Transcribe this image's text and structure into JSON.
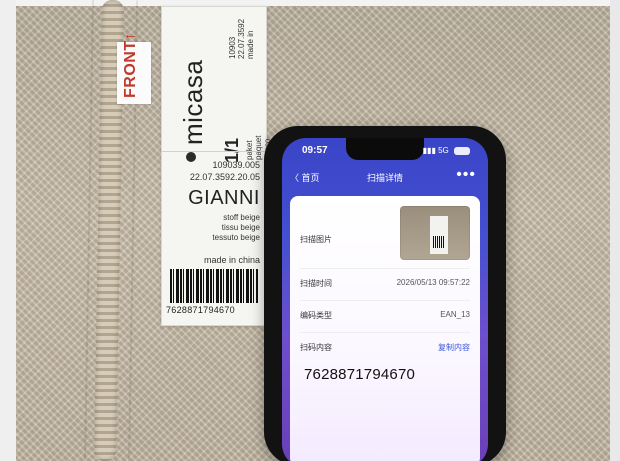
{
  "front_tag": {
    "text": "FRONT↑"
  },
  "product_label": {
    "top_code_line1": "10903",
    "top_code_line2": "22.07.3592",
    "top_code_line3": "made in",
    "brand": "micasa",
    "package_count": "1/1",
    "package_words": [
      "paket",
      "paquet",
      "pacco"
    ],
    "article_number": "109039.005",
    "item_code": "22.07.3592.20.05",
    "product_name": "GIANNI",
    "fabric_lines": [
      "stoff beige",
      "tissu beige",
      "tessuto beige"
    ],
    "origin": "made in china",
    "barcode_number": "7628871794670"
  },
  "phone": {
    "status": {
      "time": "09:57",
      "network": "5G"
    },
    "nav": {
      "back": "〈 首页",
      "title": "扫描详情",
      "more": "•••"
    },
    "details": {
      "scan_image_label": "扫描图片",
      "scan_time_label": "扫描时间",
      "scan_time_value": "2026/05/13 09:57:22",
      "code_type_label": "编码类型",
      "code_type_value": "EAN_13",
      "scan_content_label": "扫码内容",
      "copy_content": "复制内容",
      "scan_content_value": "7628871794670"
    }
  },
  "colors": {
    "accent_blue": "#3b56d6",
    "screen_top": "#3a44c7",
    "screen_bottom": "#6b3fb8",
    "front_red": "#c0392b"
  }
}
